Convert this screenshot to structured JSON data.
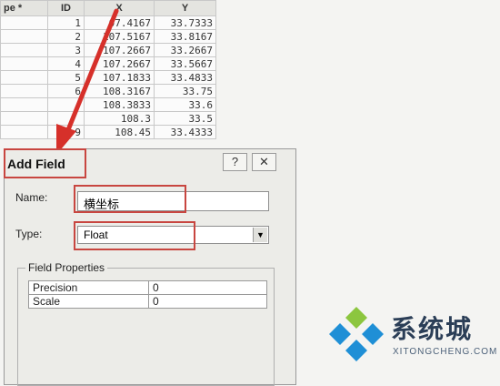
{
  "table": {
    "headers": [
      "pe *",
      "ID",
      "X",
      "Y"
    ],
    "rows": [
      [
        "",
        "1",
        "07.4167",
        "33.7333"
      ],
      [
        "",
        "2",
        "107.5167",
        "33.8167"
      ],
      [
        "",
        "3",
        "107.2667",
        "33.2667"
      ],
      [
        "",
        "4",
        "107.2667",
        "33.5667"
      ],
      [
        "",
        "5",
        "107.1833",
        "33.4833"
      ],
      [
        "",
        "6",
        "108.3167",
        "33.75"
      ],
      [
        "",
        "",
        "108.3833",
        "33.6"
      ],
      [
        "",
        "",
        "108.3",
        "33.5"
      ],
      [
        "",
        "9",
        "108.45",
        "33.4333"
      ]
    ]
  },
  "dialog": {
    "title": "Add Field",
    "help_label": "?",
    "close_label": "✕",
    "name_label": "Name:",
    "name_value": "横坐标",
    "type_label": "Type:",
    "type_value": "Float",
    "field_properties_label": "Field Properties",
    "properties": [
      {
        "key": "Precision",
        "value": "0"
      },
      {
        "key": "Scale",
        "value": "0"
      }
    ]
  },
  "colors": {
    "highlight": "#c84640",
    "arrow": "#d6302a",
    "watermark_blue": "#1f8fd6"
  },
  "watermark": {
    "text": "系统城",
    "subtext": "XITONGCHENG.COM"
  }
}
